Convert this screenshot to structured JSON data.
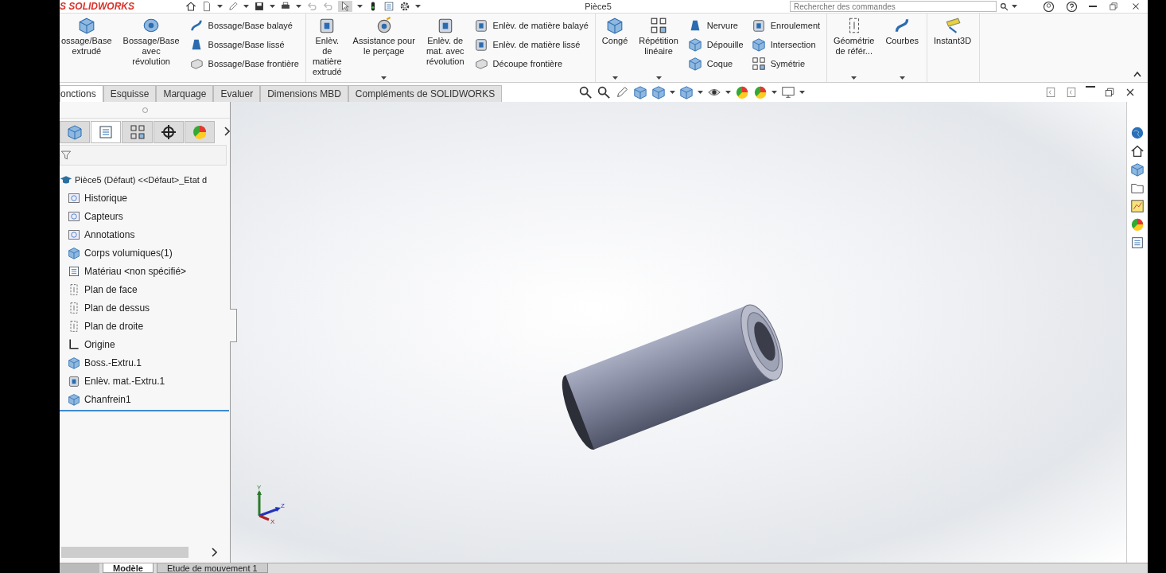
{
  "title_bar": {
    "logo": "S SOLIDWORKS",
    "document_title": "Pièce5",
    "search": {
      "placeholder": "Rechercher des commandes"
    }
  },
  "ribbon": {
    "groups": [
      {
        "columns": [
          {
            "kind": "large",
            "label": "ossage/Base\nextrudé",
            "dropdown": false
          },
          {
            "kind": "large",
            "label": "Bossage/Base\navec\nrévolution",
            "dropdown": false
          },
          {
            "kind": "stack",
            "items": [
              "Bossage/Base balayé",
              "Bossage/Base lissé",
              "Bossage/Base frontière"
            ]
          }
        ]
      },
      {
        "columns": [
          {
            "kind": "large",
            "label": "Enlèv.\nde\nmatière\nextrudé",
            "dropdown": false
          },
          {
            "kind": "large",
            "label": "Assistance pour\nle perçage",
            "dropdown": true
          },
          {
            "kind": "large",
            "label": "Enlèv. de\nmat. avec\nrévolution",
            "dropdown": false
          },
          {
            "kind": "stack",
            "items": [
              "Enlèv. de matière balayé",
              "Enlèv. de matière lissé",
              "Découpe frontière"
            ]
          }
        ]
      },
      {
        "columns": [
          {
            "kind": "large",
            "label": "Congé",
            "dropdown": true
          },
          {
            "kind": "large",
            "label": "Répétition\nlinéaire",
            "dropdown": true
          },
          {
            "kind": "stack",
            "items": [
              "Nervure",
              "Dépouille",
              "Coque"
            ]
          },
          {
            "kind": "stack",
            "items": [
              "Enroulement",
              "Intersection",
              "Symétrie"
            ]
          }
        ]
      },
      {
        "columns": [
          {
            "kind": "large",
            "label": "Géométrie\nde référ...",
            "dropdown": true
          },
          {
            "kind": "large",
            "label": "Courbes",
            "dropdown": true
          }
        ]
      },
      {
        "columns": [
          {
            "kind": "large",
            "label": "Instant3D",
            "dropdown": false
          }
        ]
      }
    ]
  },
  "command_tabs": [
    {
      "label": "onctions",
      "selected": true
    },
    {
      "label": "Esquisse",
      "selected": false
    },
    {
      "label": "Marquage",
      "selected": false
    },
    {
      "label": "Evaluer",
      "selected": false
    },
    {
      "label": "Dimensions MBD",
      "selected": false
    },
    {
      "label": "Compléments de SOLIDWORKS",
      "selected": false
    }
  ],
  "tree_panel": {
    "tabs": [
      {
        "kind": "feature",
        "selected": false
      },
      {
        "kind": "property",
        "selected": true
      },
      {
        "kind": "config",
        "selected": false
      },
      {
        "kind": "dimxpert",
        "selected": false
      },
      {
        "kind": "display",
        "selected": false
      }
    ],
    "tree": {
      "label": "Pièce5 (Défaut) <<Défaut>_Etat d",
      "kind": "part",
      "children": [
        {
          "label": "Historique",
          "kind": "history"
        },
        {
          "label": "Capteurs",
          "kind": "sensor"
        },
        {
          "label": "Annotations",
          "kind": "annotation"
        },
        {
          "label": "Corps volumiques(1)",
          "kind": "body"
        },
        {
          "label": "Matériau <non spécifié>",
          "kind": "material"
        },
        {
          "label": "Plan de face",
          "kind": "plane"
        },
        {
          "label": "Plan de dessus",
          "kind": "plane"
        },
        {
          "label": "Plan de droite",
          "kind": "plane"
        },
        {
          "label": "Origine",
          "kind": "origin"
        },
        {
          "label": "Boss.-Extru.1",
          "kind": "extrude"
        },
        {
          "label": "Enlèv. mat.-Extru.1",
          "kind": "cut"
        },
        {
          "label": "Chanfrein1",
          "kind": "chamfer"
        }
      ]
    }
  },
  "viewport": {
    "triad": {
      "x_label": "X",
      "y_label": "Y",
      "z_label": "Z"
    }
  },
  "bottom_tabs": [
    {
      "label": "Modèle",
      "selected": true
    },
    {
      "label": "Etude de mouvement 1",
      "selected": false
    }
  ]
}
